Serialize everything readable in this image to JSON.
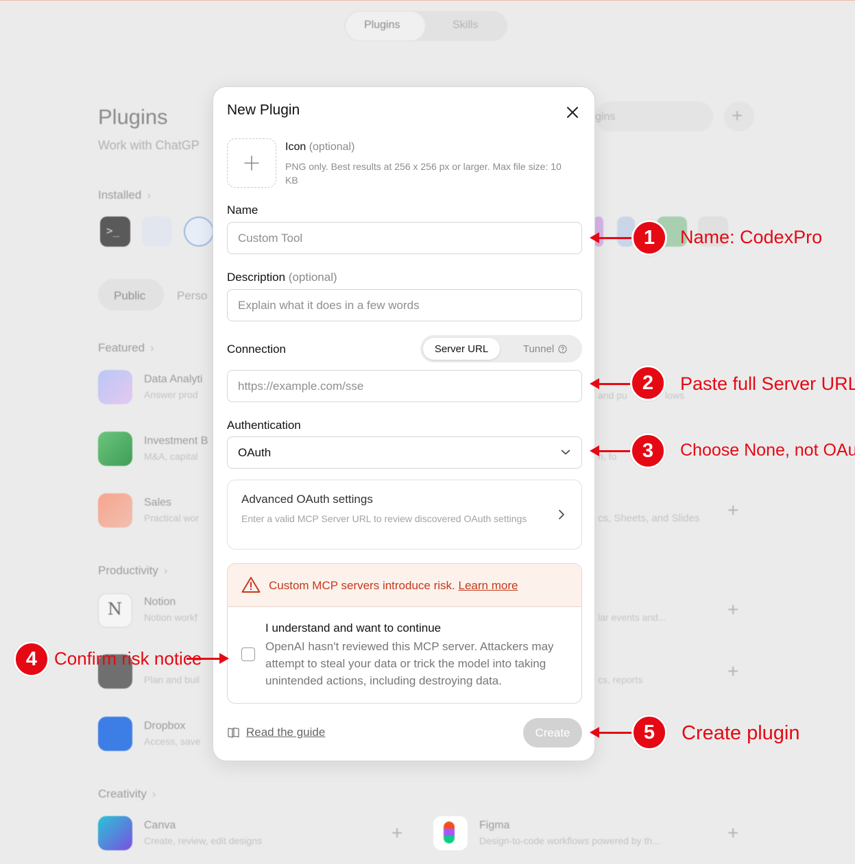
{
  "background": {
    "top_tabs": [
      "Plugins",
      "Skills"
    ],
    "page_title": "Plugins",
    "page_subtitle": "Work with ChatGP",
    "installed_label": "Installed",
    "filter_tabs": [
      "Public",
      "Perso"
    ],
    "search_placeholder": "gins",
    "featured_label": "Featured",
    "featured_items": [
      {
        "name": "Data Analyti",
        "desc": "Answer prod"
      },
      {
        "name": "Investment B",
        "desc": "M&A, capital"
      },
      {
        "name": "Sales",
        "desc": "Practical wor"
      }
    ],
    "right_fragments": [
      "and pu",
      "lows",
      "n, fo",
      "cs, Sheets, and Slides",
      "lar events and...",
      "cs, reports"
    ],
    "productivity_label": "Productivity",
    "productivity_items": [
      {
        "name": "Notion",
        "desc": "Notion workf"
      },
      {
        "name": "",
        "desc": "Plan and buil"
      },
      {
        "name": "Dropbox",
        "desc": "Access, save"
      }
    ],
    "creativity_label": "Creativity",
    "creativity_items": [
      {
        "name": "Canva",
        "desc": "Create, review, edit designs"
      },
      {
        "name": "Figma",
        "desc": "Design-to-code workflows powered by th..."
      }
    ]
  },
  "modal": {
    "title": "New Plugin",
    "icon_label": "Icon",
    "optional_suffix": "(optional)",
    "icon_help": "PNG only. Best results at 256 x 256 px or larger. Max file size: 10 KB",
    "name_label": "Name",
    "name_placeholder": "Custom Tool",
    "description_label": "Description",
    "description_placeholder": "Explain what it does in a few words",
    "connection_label": "Connection",
    "connection_options": [
      "Server URL",
      "Tunnel"
    ],
    "connection_selected": "Server URL",
    "server_url_placeholder": "https://example.com/sse",
    "authentication_label": "Authentication",
    "authentication_value": "OAuth",
    "advanced_title": "Advanced OAuth settings",
    "advanced_desc": "Enter a valid MCP Server URL to review discovered OAuth settings",
    "risk_text": "Custom MCP servers introduce risk.",
    "risk_link": "Learn more",
    "ack_title": "I understand and want to continue",
    "ack_desc": "OpenAI hasn't reviewed this MCP server. Attackers may attempt to steal your data or trick the model into taking unintended actions, including destroying data.",
    "ack_checked": false,
    "guide_link": "Read the guide",
    "create_label": "Create"
  },
  "annotations": [
    {
      "number": "1",
      "text": "Name: CodexPro"
    },
    {
      "number": "2",
      "text": "Paste full Server URL"
    },
    {
      "number": "3",
      "text": "Choose None, not OAuth"
    },
    {
      "number": "4",
      "text": "Confirm risk notice"
    },
    {
      "number": "5",
      "text": "Create plugin"
    }
  ],
  "colors": {
    "annotation_red": "#e50914",
    "risk_red": "#c33a1b",
    "risk_bg": "#fdf1ec",
    "create_disabled": "#d2d2d2"
  }
}
